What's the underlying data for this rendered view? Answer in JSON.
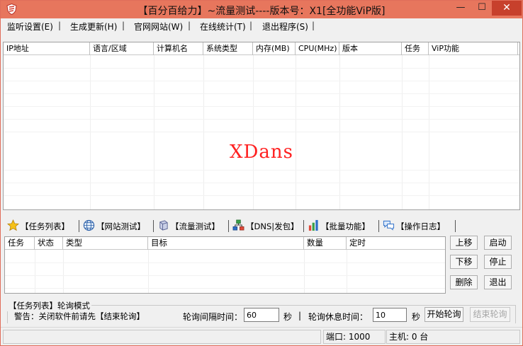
{
  "window": {
    "title": "【百分百给力】~流量测试----版本号：X1[全功能ViP版]",
    "min_glyph": "—",
    "max_glyph": "☐",
    "close_glyph": "✕",
    "title_bar_color": "#e7765d"
  },
  "menu": [
    {
      "label": "监听设置(E)"
    },
    {
      "label": "生成更新(H)"
    },
    {
      "label": "官网网站(W)"
    },
    {
      "label": "在线统计(T)"
    },
    {
      "label": "退出程序(S)"
    }
  ],
  "menu_separator": "|",
  "main_list": {
    "columns": [
      "IP地址",
      "语言/区域",
      "计算机名",
      "系统类型",
      "内存(MB)",
      "CPU(MHz)",
      "版本",
      "任务",
      "ViP功能"
    ],
    "watermark": "XDans",
    "watermark_color": "#ff2020"
  },
  "tabs": [
    {
      "label": "【任务列表】",
      "icon": "star-icon"
    },
    {
      "label": "【网站测试】",
      "icon": "globe-icon"
    },
    {
      "label": "【流量测试】",
      "icon": "cube-icon"
    },
    {
      "label": "【DNS|发包】",
      "icon": "network-icon"
    },
    {
      "label": "【批量功能】",
      "icon": "bar-chart-icon"
    },
    {
      "label": "【操作日志】",
      "icon": "chat-bubbles-icon"
    }
  ],
  "task_list": {
    "columns": [
      "任务",
      "状态",
      "类型",
      "目标",
      "数量",
      "定时"
    ]
  },
  "side_buttons": {
    "move_up": "上移",
    "start": "启动",
    "move_down": "下移",
    "stop": "停止",
    "delete": "删除",
    "exit": "退出"
  },
  "polling": {
    "group_title": "【任务列表】轮询模式",
    "warning": "警告：关闭软件前请先【结束轮询】",
    "interval_label": "轮询间隔时间：",
    "interval_value": "60",
    "interval_unit": "秒",
    "separator": "|",
    "rest_label": "轮询休息时间：",
    "rest_value": "10",
    "rest_unit": "秒",
    "start_button": "开始轮询",
    "stop_button": "结束轮询"
  },
  "status": {
    "port": "端口: 1000",
    "hosts": "主机: 0 台"
  }
}
